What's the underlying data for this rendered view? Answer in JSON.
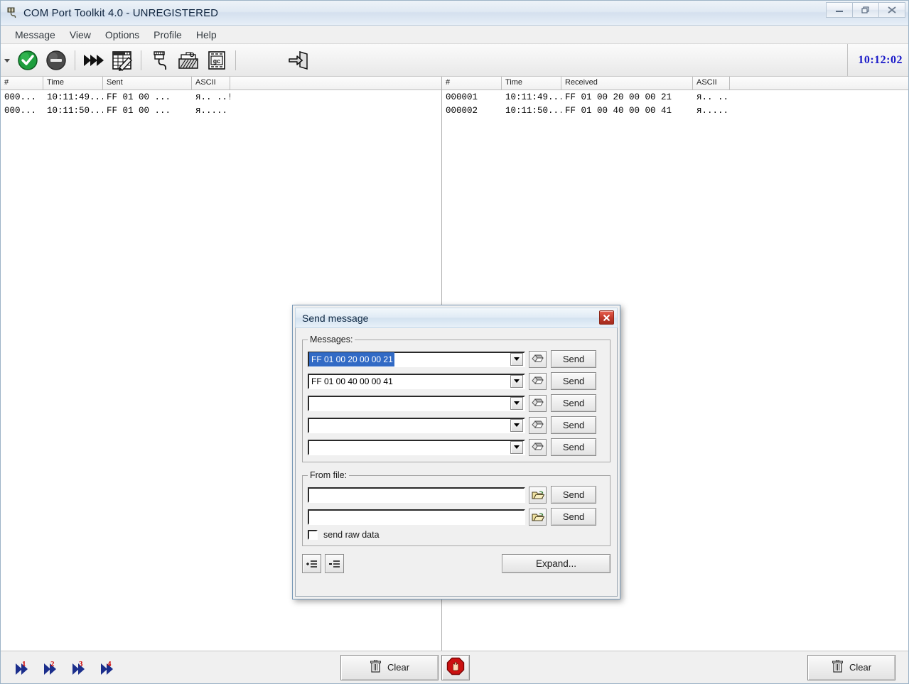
{
  "window": {
    "title": "COM Port Toolkit 4.0 - UNREGISTERED",
    "app_icon": "com-port-plug-icon",
    "controls": {
      "minimize": "minimize-icon",
      "restore": "restore-icon",
      "close": "close-icon"
    }
  },
  "menu": {
    "items": [
      {
        "label": "Message"
      },
      {
        "label": "View"
      },
      {
        "label": "Options"
      },
      {
        "label": "Profile"
      },
      {
        "label": "Help"
      }
    ]
  },
  "toolbar": {
    "overflow": "chevron-down-icon",
    "buttons": [
      {
        "name": "connect-button",
        "icon": "green-check-icon"
      },
      {
        "name": "disconnect-button",
        "icon": "gray-minus-circle-icon"
      },
      {
        "name": "send-all-button",
        "icon": "fast-forward-icon"
      },
      {
        "name": "edit-table-button",
        "icon": "table-pencil-icon"
      },
      {
        "name": "port-settings-button",
        "icon": "plug-cable-icon"
      },
      {
        "name": "toolbox-button",
        "icon": "toolbox-icon"
      },
      {
        "name": "script-button",
        "icon": "script-document-icon"
      },
      {
        "name": "exit-button",
        "icon": "exit-door-icon"
      }
    ],
    "clock": "10:12:02"
  },
  "sent_pane": {
    "columns": [
      "#",
      "Time",
      "Sent",
      "ASCII"
    ],
    "rows": [
      {
        "num": "000...",
        "time": "10:11:49....",
        "data": "FF 01 00 ...",
        "ascii": "я.. ..!"
      },
      {
        "num": "000...",
        "time": "10:11:50....",
        "data": "FF 01 00 ...",
        "ascii": "я....."
      }
    ]
  },
  "received_pane": {
    "columns": [
      "#",
      "Time",
      "Received",
      "ASCII"
    ],
    "rows": [
      {
        "num": "000001",
        "time": "10:11:49....",
        "data": "FF 01 00 20 00 00 21",
        "ascii": "я.. ..!"
      },
      {
        "num": "000002",
        "time": "10:11:50....",
        "data": "FF 01 00 40 00 00 41",
        "ascii": "я....."
      }
    ]
  },
  "bottom_bar": {
    "quick_send": [
      {
        "name": "quick-send-1",
        "label": "1",
        "icon": "fast-forward-1-icon"
      },
      {
        "name": "quick-send-2",
        "label": "2",
        "icon": "fast-forward-2-icon"
      },
      {
        "name": "quick-send-3",
        "label": "3",
        "icon": "fast-forward-3-icon"
      },
      {
        "name": "quick-send-4",
        "label": "4",
        "icon": "fast-forward-4-icon"
      }
    ],
    "clear_sent_label": "Clear",
    "clear_received_label": "Clear",
    "stop_icon": "red-stop-hand-icon",
    "trash_icon": "trash-icon"
  },
  "dialog": {
    "title": "Send message",
    "close_icon": "close-icon",
    "messages_group_label": "Messages:",
    "from_file_group_label": "From file:",
    "send_label": "Send",
    "eraser_icon": "eraser-icon",
    "folder_icon": "open-folder-icon",
    "message_rows": [
      {
        "value": "FF 01 00 20 00 00 21",
        "selected": true
      },
      {
        "value": "FF 01 00 40 00 00 41",
        "selected": false
      },
      {
        "value": "",
        "selected": false
      },
      {
        "value": "",
        "selected": false
      },
      {
        "value": "",
        "selected": false
      }
    ],
    "file_rows": [
      {
        "value": ""
      },
      {
        "value": ""
      }
    ],
    "raw_data_label": "send raw data",
    "raw_data_checked": false,
    "add_line_icon": "add-line-icon",
    "remove_line_icon": "remove-line-icon",
    "expand_label": "Expand..."
  },
  "colors": {
    "accent_blue": "#316ac5",
    "clock_blue": "#1919c8",
    "close_red": "#c0392b",
    "ok_green": "#1d9e3d"
  }
}
